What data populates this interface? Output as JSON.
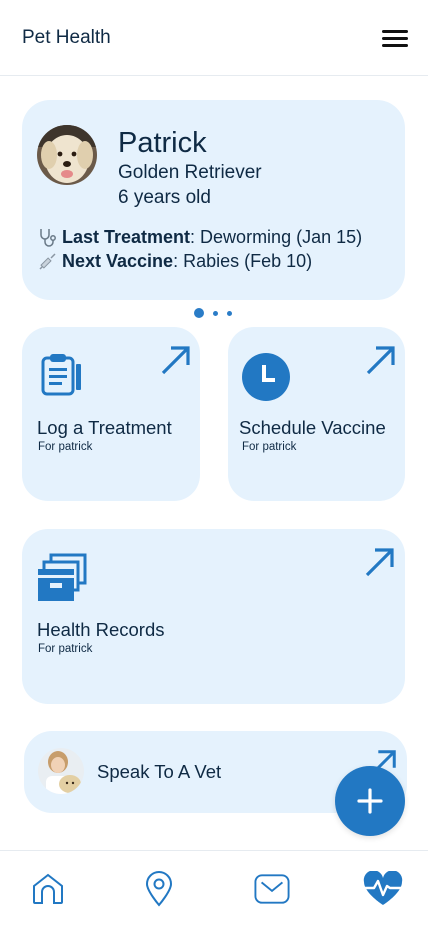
{
  "header": {
    "title": "Pet Health",
    "menu_icon": "hamburger-menu-icon"
  },
  "pet": {
    "name": "Patrick",
    "breed": "Golden Retriever",
    "age": "6 years old",
    "avatar": "golden-retriever-photo",
    "last_treatment_label": "Last Treatment",
    "last_treatment_value": ": Deworming (Jan 15)",
    "next_vaccine_label": "Next Vaccine",
    "next_vaccine_value": ": Rabies (Feb 10)"
  },
  "carousel": {
    "pages": 3,
    "active_index": 0
  },
  "tiles": {
    "log_treatment": {
      "title": "Log a Treatment",
      "subtitle": "For patrick",
      "icon": "clipboard-icon"
    },
    "schedule_vaccine": {
      "title": "Schedule Vaccine",
      "subtitle": "For patrick",
      "icon": "clock-icon"
    },
    "health_records": {
      "title": "Health Records",
      "subtitle": "For patrick",
      "icon": "file-boxes-icon"
    }
  },
  "vet": {
    "label": "Speak To A Vet",
    "avatar": "vet-photo"
  },
  "fab": {
    "icon": "plus-icon"
  },
  "nav": {
    "items": [
      "home-icon",
      "location-pin-icon",
      "mail-icon",
      "heart-pulse-icon"
    ],
    "active": "heart-pulse-icon"
  },
  "colors": {
    "accent": "#2278c3",
    "card_bg": "#e5f2fd",
    "text_primary": "#0f2a44"
  }
}
